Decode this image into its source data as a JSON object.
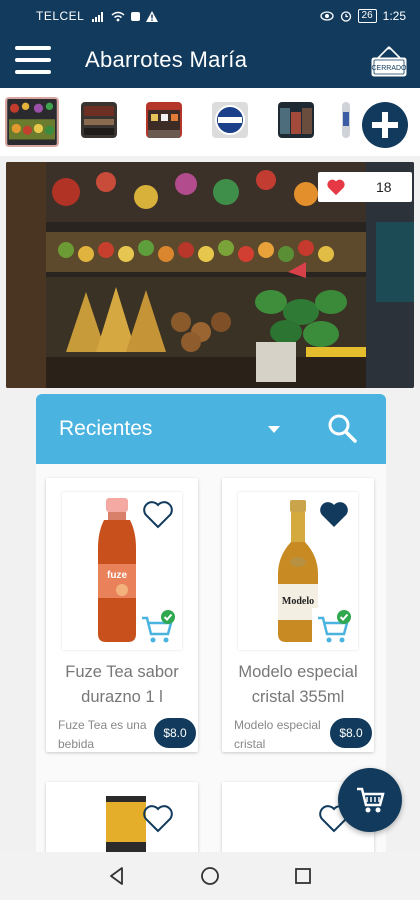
{
  "status_bar": {
    "carrier": "TELCEL",
    "battery": "26",
    "time": "1:25"
  },
  "app_bar": {
    "title": "Abarrotes María",
    "closed_sign": "CERRADO"
  },
  "hero": {
    "likes": "18"
  },
  "panel": {
    "title": "Recientes"
  },
  "products": [
    {
      "name": "Fuze Tea sabor durazno 1 l",
      "description": "Fuze Tea es una bebida",
      "price": "$8.0",
      "favorited": false
    },
    {
      "name": "Modelo especial cristal 355ml",
      "description": "Modelo especial cristal",
      "price": "$8.0",
      "favorited": true
    }
  ],
  "colors": {
    "primary": "#113a5c",
    "accent": "#4ab3df",
    "like": "#e53945",
    "check": "#2fa84f"
  },
  "icons": [
    "menu-icon",
    "closed-sign-icon",
    "add-icon",
    "heart-icon",
    "dropdown-icon",
    "search-icon",
    "cart-icon",
    "back-icon",
    "home-icon",
    "recents-icon"
  ]
}
